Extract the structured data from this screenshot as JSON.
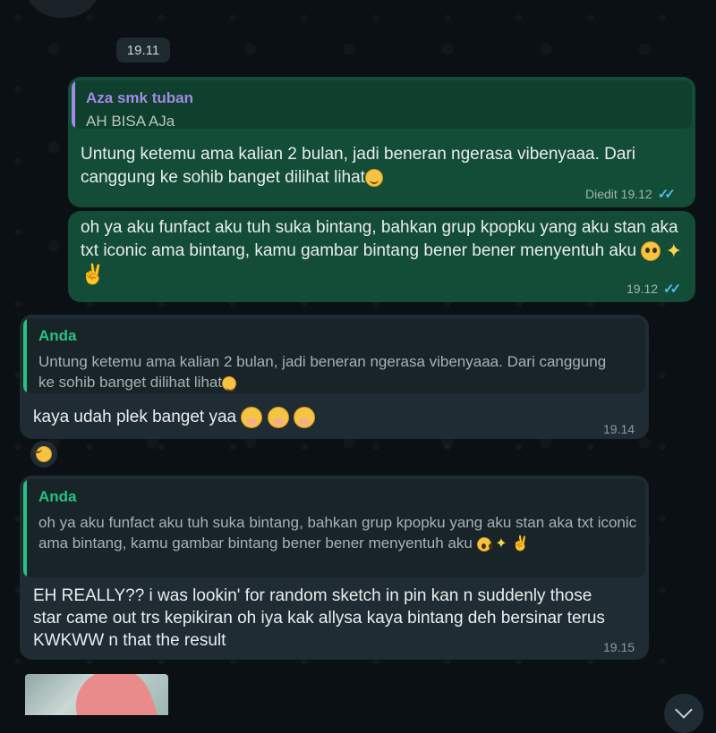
{
  "chat": {
    "top_time": "19.11",
    "messages": [
      {
        "quote_name": "Aza smk tuban",
        "quote_text": "AH BISA AJa",
        "text": "Untung ketemu ama kalian 2 bulan, jadi beneran ngerasa vibenyaaa. Dari canggung ke sohib banget dilihat lihat",
        "meta": "Diedit 19.12"
      },
      {
        "text": "oh ya aku funfact aku tuh suka bintang, bahkan grup kpopku yang aku stan aka txt iconic ama bintang, kamu gambar bintang bener bener menyentuh aku",
        "meta": "19.12"
      },
      {
        "quote_name": "Anda",
        "quote_text": "Untung ketemu ama kalian 2 bulan, jadi beneran ngerasa vibenyaaa. Dari canggung ke sohib banget dilihat lihat",
        "text": "kaya udah plek banget yaa",
        "meta": "19.14"
      },
      {
        "quote_name": "Anda",
        "quote_text": "oh ya aku funfact aku tuh suka bintang, bahkan grup kpopku yang aku stan aka txt iconic ama bintang, kamu gambar bintang bener bener menyentuh aku",
        "text": "EH REALLY?? i was lookin' for random sketch in pin kan n suddenly those star came out trs kepikiran oh iya kak allysa kaya bintang deh bersinar terus KWKWW n that the result",
        "meta": "19.15"
      }
    ]
  },
  "colors": {
    "outgoing_bubble": "#134d37",
    "incoming_bubble": "#1f2c33",
    "reply_accent_purple": "#a18ae6",
    "reply_accent_green": "#26c281",
    "read_ticks": "#53bdeb"
  },
  "icons": {
    "emoji_rofl": "rolling-on-the-floor-laughing",
    "emoji_pleading": "pleading-face",
    "emoji_sparkles": "sparkles",
    "emoji_crossed_fingers": "crossed-fingers",
    "emoji_hand_over_mouth": "face-with-hand-over-mouth",
    "reaction": "laughing-face",
    "scroll_down": "chevron-down"
  }
}
